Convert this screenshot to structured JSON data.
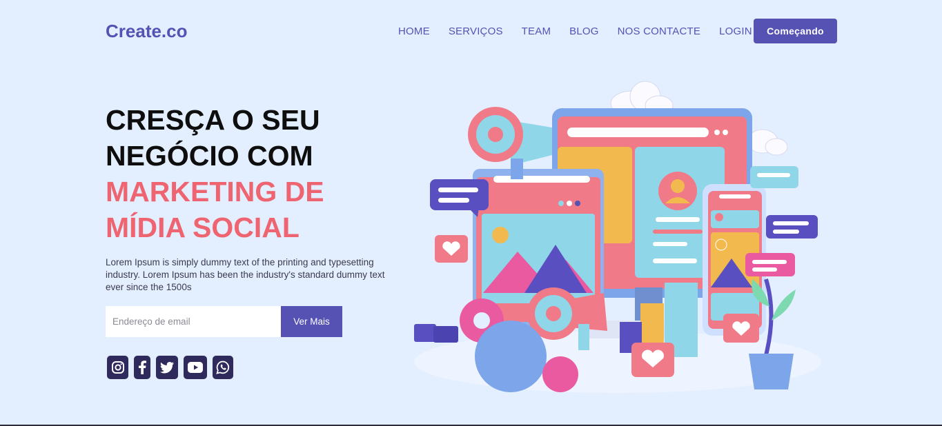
{
  "brand": {
    "name": "Create.co"
  },
  "nav": {
    "items": [
      "HOME",
      "SERVIÇOS",
      "TEAM",
      "BLOG",
      "NOS CONTACTE",
      "LOGIN"
    ],
    "cta_label": "Começando"
  },
  "hero": {
    "title_line1": "CRESÇA O SEU",
    "title_line2": "NEGÓCIO COM",
    "title_accent1": "MARKETING DE",
    "title_accent2": "MÍDIA SOCIAL",
    "description": "Lorem Ipsum is simply dummy text of the printing and typesetting industry. Lorem Ipsum has been the industry's standard dummy text ever since the 1500s",
    "email_placeholder": "Endereço de email",
    "email_value": "",
    "submit_label": "Ver Mais"
  },
  "social": [
    "instagram-icon",
    "facebook-icon",
    "twitter-icon",
    "youtube-icon",
    "whatsapp-icon"
  ],
  "colors": {
    "background": "#e3efff",
    "primary": "#5552b4",
    "accent": "#ee6470",
    "social_bg": "#2f2a5c"
  }
}
